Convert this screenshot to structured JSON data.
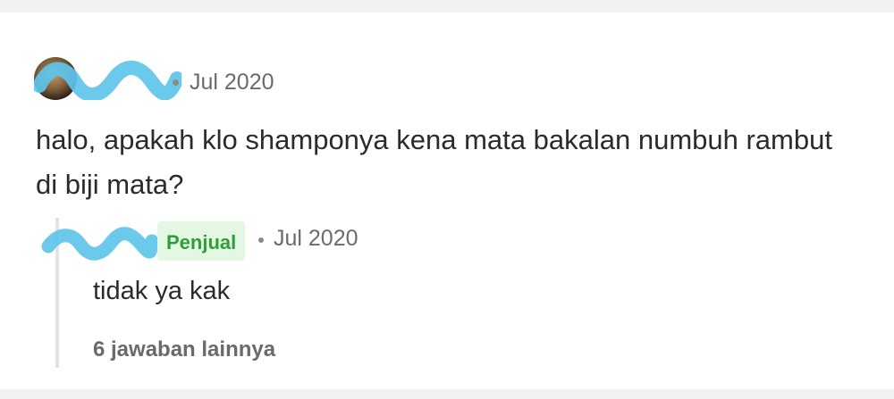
{
  "question": {
    "avatar_icon": "user-avatar",
    "date": "Jul 2020",
    "text": "halo, apakah klo shamponya kena mata bakalan numbuh rambut di biji mata?"
  },
  "reply": {
    "badge": "Penjual",
    "date": "Jul 2020",
    "text": "tidak ya kak"
  },
  "more_replies_label": "6 jawaban lainnya",
  "colors": {
    "scribble": "#5ec4ea",
    "badge_bg": "#e3f7e3",
    "badge_text": "#2f9e3a"
  }
}
